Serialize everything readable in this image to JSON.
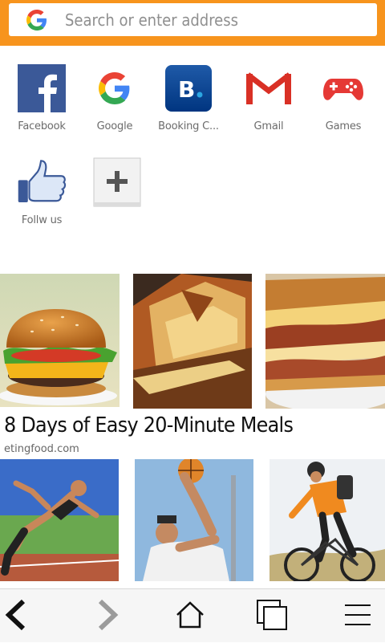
{
  "address_bar": {
    "placeholder": "Search or enter address",
    "logo_icon": "google-g-icon",
    "background_color": "#f7941d"
  },
  "shortcuts": [
    {
      "label": "Facebook",
      "icon": "facebook-icon"
    },
    {
      "label": "Google",
      "icon": "google-icon"
    },
    {
      "label": "Booking C...",
      "icon": "booking-icon"
    },
    {
      "label": "Gmail",
      "icon": "gmail-icon"
    },
    {
      "label": "Games",
      "icon": "gamepad-icon"
    },
    {
      "label": "Follw us",
      "icon": "thumbs-up-icon"
    },
    {
      "label": "",
      "icon": "add-icon"
    }
  ],
  "feed": {
    "article_1": {
      "title": "8 Days of Easy 20-Minute Meals",
      "source": "etingfood.com",
      "images": [
        "burger-image",
        "grilled-sandwich-image",
        "bacon-sandwich-image"
      ]
    },
    "article_2": {
      "images": [
        "sprinter-image",
        "basketball-image",
        "cyclist-image"
      ]
    }
  },
  "bottom_nav": {
    "items": [
      "back-icon",
      "forward-icon",
      "home-icon",
      "tabs-icon",
      "menu-icon"
    ]
  }
}
